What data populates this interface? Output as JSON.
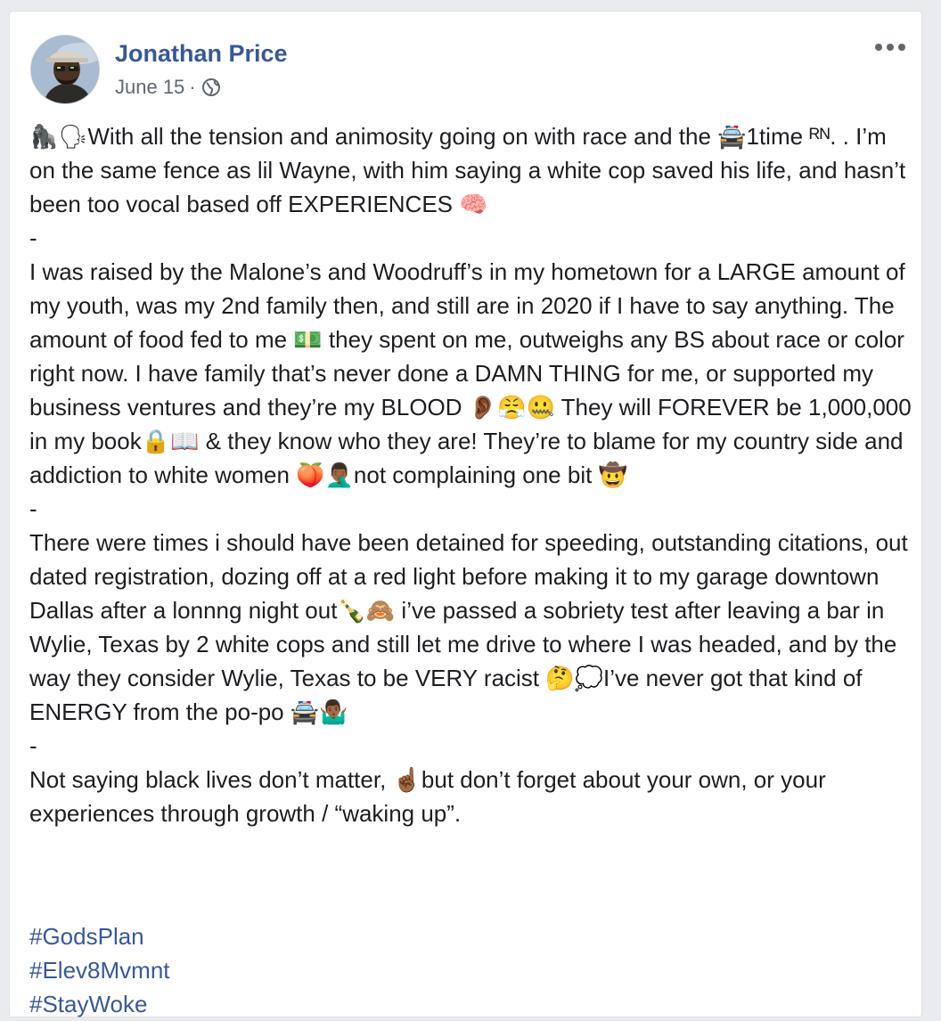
{
  "post": {
    "author": "Jonathan Price",
    "date": "June 15",
    "separator": "·",
    "privacy_icon": "globe-icon",
    "more_icon": "more-options-icon",
    "avatar": "profile-photo",
    "paragraphs": [
      "🦍🗣With all the tension and animosity going on with race and the 🚔1time ᴿᴺ. . I’m on the same fence as lil Wayne, with him saying a white cop saved his life, and hasn’t been too vocal based off EXPERIENCES 🧠",
      "-",
      "I was raised by the Malone’s and Woodruff’s in my hometown for a LARGE amount of my youth, was my 2nd family then, and still are in 2020 if I have to say anything. The amount of food fed to me 💵 they spent on me, outweighs any BS about race or color right now. I have family that’s never done a DAMN THING for me, or supported my business ventures and they’re my BLOOD 👂🏾😤🤐 They will FOREVER be 1,000,000 in my book🔒📖 & they know who they are! They’re to blame for my country side and addiction to white women 🍑🤦🏾‍♂️not complaining one bit 🤠",
      "-",
      "There were times i should have been detained for speeding, outstanding citations, out dated registration, dozing off at a red light before making it to my garage downtown Dallas after a lonnng night out🍾🙈 i’ve passed a sobriety test after leaving a bar in Wylie, Texas by 2 white cops and still let me drive to where I was headed, and by the way they consider Wylie, Texas to be VERY racist 🤔💭I’ve never got that kind of ENERGY from the po-po 🚔🤷🏾‍♂️",
      "-",
      "Not saying black lives don’t matter, ☝🏾but don’t forget about your own, or your experiences through growth / “waking up”."
    ],
    "hashtags": [
      "#GodsPlan",
      "#Elev8Mvmnt",
      "#StayWoke"
    ]
  },
  "colors": {
    "link": "#385898",
    "text": "#1c1e21",
    "meta": "#606770",
    "background": "#e9ebee"
  }
}
